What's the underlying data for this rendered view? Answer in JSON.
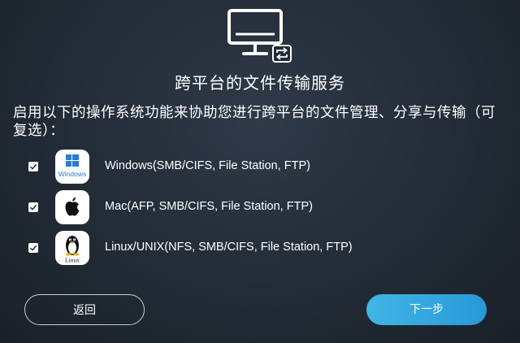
{
  "title": "跨平台的文件传输服务",
  "description": "启用以下的操作系统功能来协助您进行跨平台的文件管理、分享与传输（可复选）：",
  "options": [
    {
      "label": "Windows(SMB/CIFS, File Station, FTP)",
      "checked": true,
      "icon": "windows-icon",
      "icon_caption": "Windows"
    },
    {
      "label": "Mac(AFP, SMB/CIFS, File Station, FTP)",
      "checked": true,
      "icon": "apple-icon"
    },
    {
      "label": "Linux/UNIX(NFS, SMB/CIFS, File Station, FTP)",
      "checked": true,
      "icon": "linux-tux-icon",
      "icon_caption": "Linux"
    }
  ],
  "buttons": {
    "back": "返回",
    "next": "下一步"
  },
  "colors": {
    "accent": "#34a9e0",
    "windows_blue": "#2b7bd6"
  }
}
